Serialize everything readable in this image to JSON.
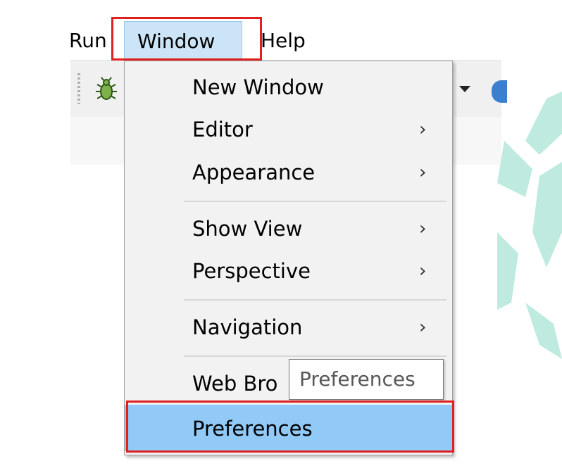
{
  "menubar": {
    "items": [
      {
        "label": "Run"
      },
      {
        "label": "Window"
      },
      {
        "label": "Help"
      }
    ]
  },
  "toolbar": {
    "debug_icon": "bug-icon",
    "dropdown_icon": "dropdown-arrow-icon",
    "next_icon": "globe-icon"
  },
  "window_menu": {
    "items": [
      {
        "label": "New Window",
        "submenu": false
      },
      {
        "label": "Editor",
        "submenu": true
      },
      {
        "label": "Appearance",
        "submenu": true
      },
      {
        "label": "Show View",
        "submenu": true
      },
      {
        "label": "Perspective",
        "submenu": true
      },
      {
        "label": "Navigation",
        "submenu": true
      },
      {
        "label": "Web Browser",
        "visible_text": "Web Bro",
        "submenu": true
      },
      {
        "label": "Preferences",
        "submenu": false,
        "selected": true
      }
    ],
    "submenu_arrow": "›"
  },
  "tooltip": {
    "text": "Preferences"
  },
  "colors": {
    "highlight_box": "#e02020",
    "selected_item": "#91c9f7",
    "active_menu": "#cce4f7",
    "watermark": "#bfeadf"
  }
}
